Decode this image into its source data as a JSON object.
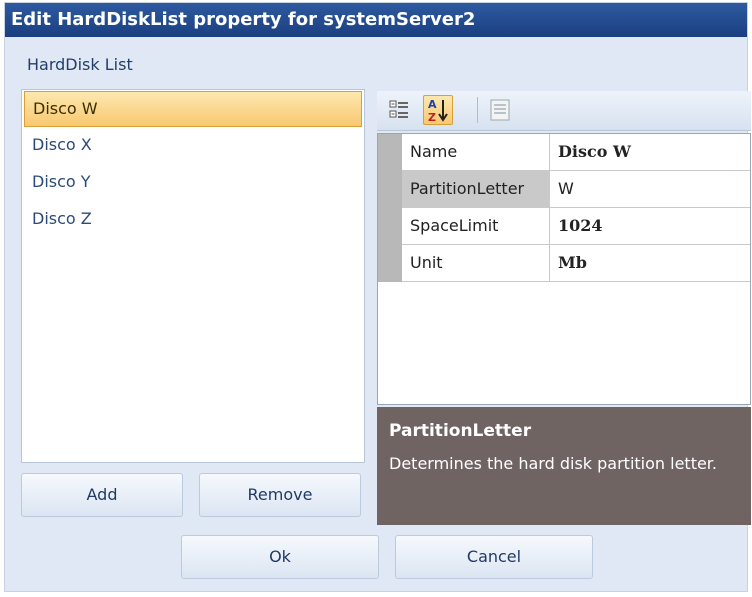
{
  "dialog": {
    "title": "Edit HardDiskList property for systemServer2",
    "group_label": "HardDisk List"
  },
  "list": {
    "items": [
      {
        "label": "Disco W",
        "selected": true
      },
      {
        "label": "Disco X",
        "selected": false
      },
      {
        "label": "Disco Y",
        "selected": false
      },
      {
        "label": "Disco Z",
        "selected": false
      }
    ]
  },
  "buttons": {
    "add": "Add",
    "remove": "Remove",
    "ok": "Ok",
    "cancel": "Cancel"
  },
  "toolbar": {
    "categorized_icon": "categorized-view-icon",
    "alphabetical_icon": "sort-alphabetical-icon",
    "alphabetical_active": true,
    "property_pages_icon": "property-pages-icon"
  },
  "properties": {
    "rows": [
      {
        "name": "Name",
        "value": "Disco W",
        "selected": false
      },
      {
        "name": "PartitionLetter",
        "value": "W",
        "selected": true
      },
      {
        "name": "SpaceLimit",
        "value": "1024",
        "selected": false
      },
      {
        "name": "Unit",
        "value": "Mb",
        "selected": false
      }
    ]
  },
  "help": {
    "title": "PartitionLetter",
    "text": "Determines the hard disk partition letter."
  },
  "colors": {
    "title_bar": "#1f4a8c",
    "dialog_bg": "#dfe8f4",
    "selection": "#f8c870",
    "help_bg": "#6f6462"
  }
}
